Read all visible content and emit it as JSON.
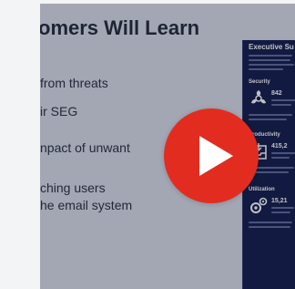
{
  "video": {
    "slide": {
      "title": "omers Will Learn",
      "bullets": [
        "from threats",
        "ir SEG",
        "npact of unwant",
        "ching users",
        "he email system"
      ]
    },
    "summary_panel": {
      "title": "Executive Su",
      "sections": [
        {
          "heading": "Security",
          "number": "842",
          "icon": "biohazard-icon"
        },
        {
          "heading": "Productivity",
          "number": "415,2",
          "icon": "inbox-icon"
        },
        {
          "heading": "Utilization",
          "number": "15,21",
          "icon": "gears-icon"
        }
      ]
    },
    "play_button": {
      "icon": "play-icon",
      "color": "#e32c20"
    }
  }
}
